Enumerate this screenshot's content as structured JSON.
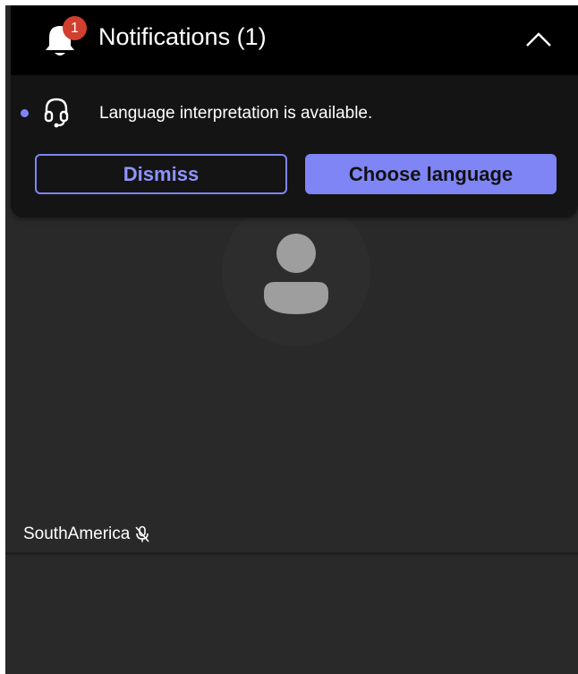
{
  "notifications": {
    "title": "Notifications (1)",
    "badge_count": "1",
    "items": [
      {
        "message": "Language interpretation is available.",
        "icon": "headset-icon",
        "unread": true
      }
    ],
    "dismiss_label": "Dismiss",
    "choose_language_label": "Choose language",
    "collapse_icon": "chevron-up-icon"
  },
  "participant": {
    "name": "SouthAmerica",
    "mic_icon": "mic-muted-icon",
    "avatar_icon": "person-avatar-icon"
  },
  "colors": {
    "accent": "#7F85F5",
    "badge": "#D13F2F",
    "panel_background": "#141414",
    "header_background": "#000000",
    "stage_background": "#292929"
  }
}
